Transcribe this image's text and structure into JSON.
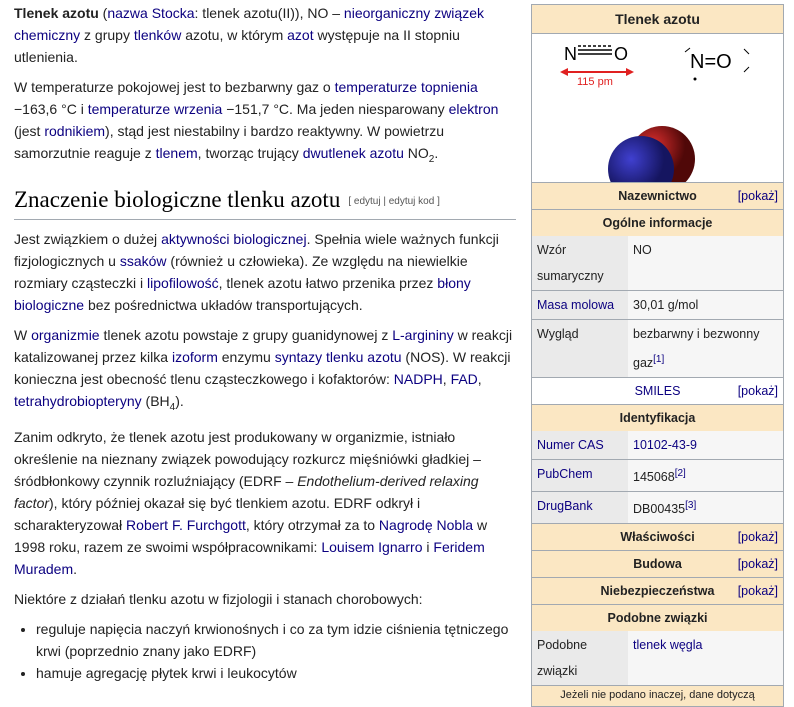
{
  "paragraphs_intro": [
    [
      {
        "t": "Tlenek azotu",
        "b": 1
      },
      {
        "t": " ("
      },
      {
        "t": "nazwa Stocka",
        "l": 1
      },
      {
        "t": ": tlenek azotu(II)), NO – "
      },
      {
        "t": "nieorganiczny związek chemiczny",
        "l": 1
      },
      {
        "t": " z grupy "
      },
      {
        "t": "tlenków",
        "l": 1
      },
      {
        "t": " azotu, w którym "
      },
      {
        "t": "azot",
        "l": 1
      },
      {
        "t": " występuje na II stopniu utlenienia."
      }
    ],
    [
      {
        "t": "W temperaturze pokojowej jest to bezbarwny gaz o "
      },
      {
        "t": "temperaturze topnienia",
        "l": 1
      },
      {
        "t": " −163,6 °C i "
      },
      {
        "t": "temperaturze wrzenia",
        "l": 1
      },
      {
        "t": " −151,7 °C. Ma jeden niesparowany "
      },
      {
        "t": "elektron",
        "l": 1
      },
      {
        "t": " (jest "
      },
      {
        "t": "rodnikiem",
        "l": 1
      },
      {
        "t": "), stąd jest niestabilny i bardzo reaktywny. W powietrzu samorzutnie reaguje z "
      },
      {
        "t": "tlenem",
        "l": 1
      },
      {
        "t": ", tworząc trujący "
      },
      {
        "t": "dwutlenek azotu",
        "l": 1
      },
      {
        "t": " NO"
      },
      {
        "t": "2",
        "sub": 1
      },
      {
        "t": "."
      }
    ]
  ],
  "section": {
    "title": "Znaczenie biologiczne tlenku azotu",
    "edit": "[ edytuj | edytuj kod ]"
  },
  "paragraphs_section": [
    [
      {
        "t": "Jest związkiem o dużej "
      },
      {
        "t": "aktywności biologicznej",
        "l": 1
      },
      {
        "t": ". Spełnia wiele ważnych funkcji fizjologicznych u "
      },
      {
        "t": "ssaków",
        "l": 1
      },
      {
        "t": " (również u człowieka). Ze względu na niewielkie rozmiary cząsteczki i "
      },
      {
        "t": "lipofilowość",
        "l": 1
      },
      {
        "t": ", tlenek azotu łatwo przenika przez "
      },
      {
        "t": "błony biologiczne",
        "l": 1
      },
      {
        "t": " bez pośrednictwa układów transportujących."
      }
    ],
    [
      {
        "t": "W "
      },
      {
        "t": "organizmie",
        "l": 1
      },
      {
        "t": " tlenek azotu powstaje z grupy guanidynowej z "
      },
      {
        "t": "L-argininy",
        "l": 1
      },
      {
        "t": " w reakcji katalizowanej przez kilka "
      },
      {
        "t": "izoform",
        "l": 1
      },
      {
        "t": " enzymu "
      },
      {
        "t": "syntazy tlenku azotu",
        "l": 1
      },
      {
        "t": " (NOS). W reakcji konieczna jest obecność tlenu cząsteczkowego i kofaktorów: "
      },
      {
        "t": "NADPH",
        "l": 1
      },
      {
        "t": ", "
      },
      {
        "t": "FAD",
        "l": 1
      },
      {
        "t": ", "
      },
      {
        "t": "tetrahydrobiopteryny",
        "l": 1
      },
      {
        "t": " (BH"
      },
      {
        "t": "4",
        "sub": 1
      },
      {
        "t": ")."
      }
    ],
    [
      {
        "t": "Zanim odkryto, że tlenek azotu jest produkowany w organizmie, istniało określenie na nieznany związek powodujący rozkurcz mięśniówki gładkiej – śródbłonkowy czynnik rozluźniający (EDRF – "
      },
      {
        "t": "Endothelium-derived relaxing factor",
        "i": 1
      },
      {
        "t": "), który później okazał się być tlenkiem azotu. EDRF odkrył i scharakteryzował "
      },
      {
        "t": "Robert F. Furchgott",
        "l": 1
      },
      {
        "t": ", który otrzymał za to "
      },
      {
        "t": "Nagrodę Nobla",
        "l": 1
      },
      {
        "t": " w 1998 roku, razem ze swoimi współpracownikami: "
      },
      {
        "t": "Louisem Ignarro",
        "l": 1
      },
      {
        "t": " i "
      },
      {
        "t": "Feridem Muradem",
        "l": 1
      },
      {
        "t": "."
      }
    ],
    [
      {
        "t": "Niektóre z działań tlenku azotu w fizjologii i stanach chorobowych:"
      }
    ]
  ],
  "list": [
    "reguluje napięcia naczyń krwionośnych i co za tym idzie ciśnienia tętniczego krwi (poprzednio znany jako EDRF)",
    "hamuje agregację płytek krwi i leukocytów"
  ],
  "infobox": {
    "title": "Tlenek azotu",
    "bond_formula_n": "N",
    "bond_formula_o": "O",
    "bond_length": "115 pm",
    "lewis": "N=O",
    "show": "[pokaż]",
    "nomenclature": "Nazewnictwo",
    "general": "Ogólne informacje",
    "rows_general": [
      {
        "label": "Wzór sumaryczny",
        "value": "NO"
      },
      {
        "label": "Masa molowa",
        "value": "30,01 g/mol",
        "link": 1
      },
      {
        "label": "Wygląd",
        "value": "bezbarwny i bezwonny gaz",
        "ref": "[1]"
      }
    ],
    "smiles": "SMILES",
    "ident": "Identyfikacja",
    "rows_ident": [
      {
        "label": "Numer CAS",
        "value": "10102-43-9",
        "link": 1,
        "vlink": 1
      },
      {
        "label": "PubChem",
        "value": "145068",
        "ref": "[2]",
        "link": 1
      },
      {
        "label": "DrugBank",
        "value": "DB00435",
        "ref": "[3]",
        "link": 1
      }
    ],
    "props": "Właściwości",
    "structure": "Budowa",
    "hazards": "Niebezpieczeństwa",
    "similar": "Podobne związki",
    "rows_similar": [
      {
        "label": "Podobne związki",
        "value": "tlenek węgla",
        "vlink": 1
      }
    ],
    "footer": "Jeżeli nie podano inaczej, dane dotyczą"
  },
  "colors": {
    "link": "#0b0080",
    "header": "#fbe7c3",
    "nitrogen": "#2a2aa0",
    "oxygen": "#b01818"
  }
}
